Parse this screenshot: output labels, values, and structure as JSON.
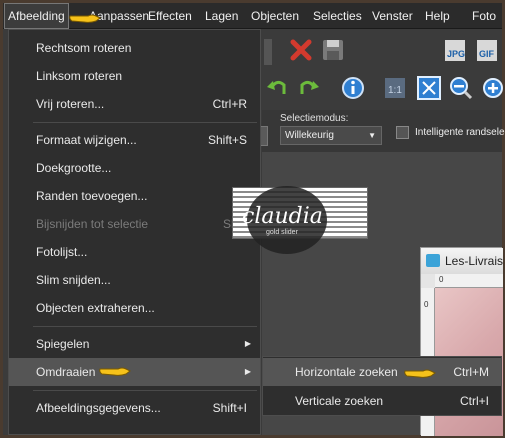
{
  "menubar": {
    "items": [
      {
        "label": "Afbeelding"
      },
      {
        "label": "Aanpassen"
      },
      {
        "label": "Effecten"
      },
      {
        "label": "Lagen"
      },
      {
        "label": "Objecten"
      },
      {
        "label": "Selecties"
      },
      {
        "label": "Venster"
      },
      {
        "label": "Help"
      },
      {
        "label": "Foto"
      }
    ]
  },
  "dropdown": {
    "items": [
      {
        "label": "Rechtsom roteren",
        "shortcut": ""
      },
      {
        "label": "Linksom roteren",
        "shortcut": ""
      },
      {
        "label": "Vrij roteren...",
        "shortcut": "Ctrl+R"
      },
      {
        "label": "Formaat wijzigen...",
        "shortcut": "Shift+S"
      },
      {
        "label": "Doekgrootte...",
        "shortcut": ""
      },
      {
        "label": "Randen toevoegen...",
        "shortcut": ""
      },
      {
        "label": "Bijsnijden tot selectie",
        "shortcut": "Shift"
      },
      {
        "label": "Fotolijst...",
        "shortcut": ""
      },
      {
        "label": "Slim snijden...",
        "shortcut": ""
      },
      {
        "label": "Objecten extraheren...",
        "shortcut": ""
      },
      {
        "label": "Spiegelen",
        "shortcut": ""
      },
      {
        "label": "Omdraaien",
        "shortcut": ""
      },
      {
        "label": "Afbeeldingsgegevens...",
        "shortcut": "Shift+I"
      }
    ]
  },
  "submenu": {
    "items": [
      {
        "label": "Horizontale zoeken",
        "shortcut": "Ctrl+M"
      },
      {
        "label": "Verticale zoeken",
        "shortcut": "Ctrl+I"
      }
    ]
  },
  "propbar": {
    "selection_mode_label": "Selectiemodus:",
    "selection_mode_value": "Willekeurig",
    "smart_edges_label": "Intelligente randselec"
  },
  "document": {
    "title": "Les-Livrais",
    "ruler_h": "0",
    "ruler_v": "0"
  },
  "watermark": {
    "text": "claudia",
    "sub": "gold slider"
  },
  "colors": {
    "menu_bg": "#2e2e2e",
    "highlight": "#555555",
    "hand": "#f6c21a"
  },
  "icons": [
    "hand-pointer-icon",
    "close-red-x-icon",
    "save-icon",
    "jpeg-export-icon",
    "gif-export-icon",
    "undo-icon",
    "redo-icon",
    "info-icon",
    "actual-size-icon",
    "fit-window-icon",
    "zoom-out-icon",
    "zoom-in-icon"
  ]
}
